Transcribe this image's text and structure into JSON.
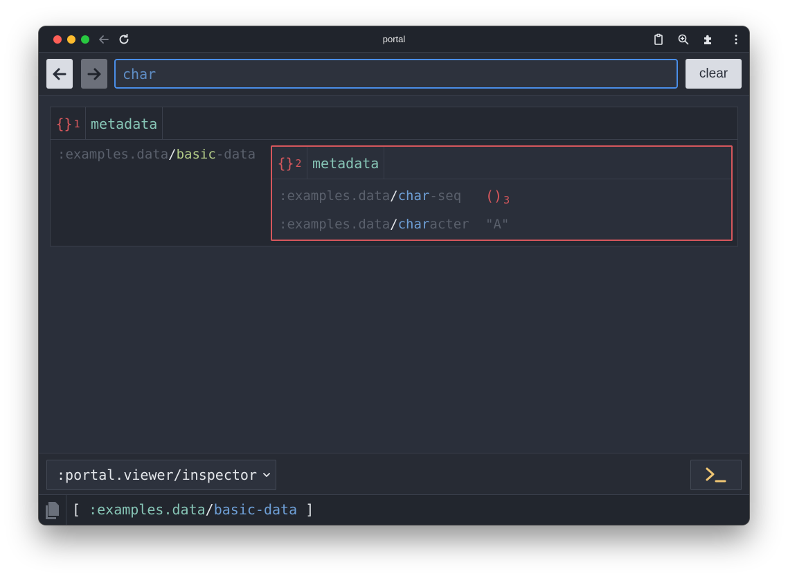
{
  "window": {
    "title": "portal"
  },
  "toolbar": {
    "search_value": "char",
    "clear_label": "clear"
  },
  "outer": {
    "badge_symbol": "{}",
    "badge_index": "1",
    "label": "metadata",
    "key": {
      "prefix": ":examples.data",
      "slash": "/",
      "match": "basic",
      "rest": "-data"
    }
  },
  "inner": {
    "badge_symbol": "{}",
    "badge_index": "2",
    "label": "metadata",
    "rows": [
      {
        "prefix": ":examples.data",
        "slash": "/",
        "match": "char",
        "rest": "-seq",
        "value_symbol": "()",
        "value_index": "3"
      },
      {
        "prefix": ":examples.data",
        "slash": "/",
        "match": "char",
        "rest": "acter",
        "value": "\"A\""
      }
    ]
  },
  "bottom": {
    "viewer": ":portal.viewer/inspector"
  },
  "status": {
    "open_bracket": "[",
    "ns": ":examples.data",
    "slash": "/",
    "name": "basic-data",
    "close_bracket": "]"
  },
  "colors": {
    "accent_blue": "#4a8ee8",
    "coll_red": "#d6575c",
    "meta_teal": "#86c4b5",
    "match_green": "#b3cc88",
    "cmd_yellow": "#f0c674"
  }
}
